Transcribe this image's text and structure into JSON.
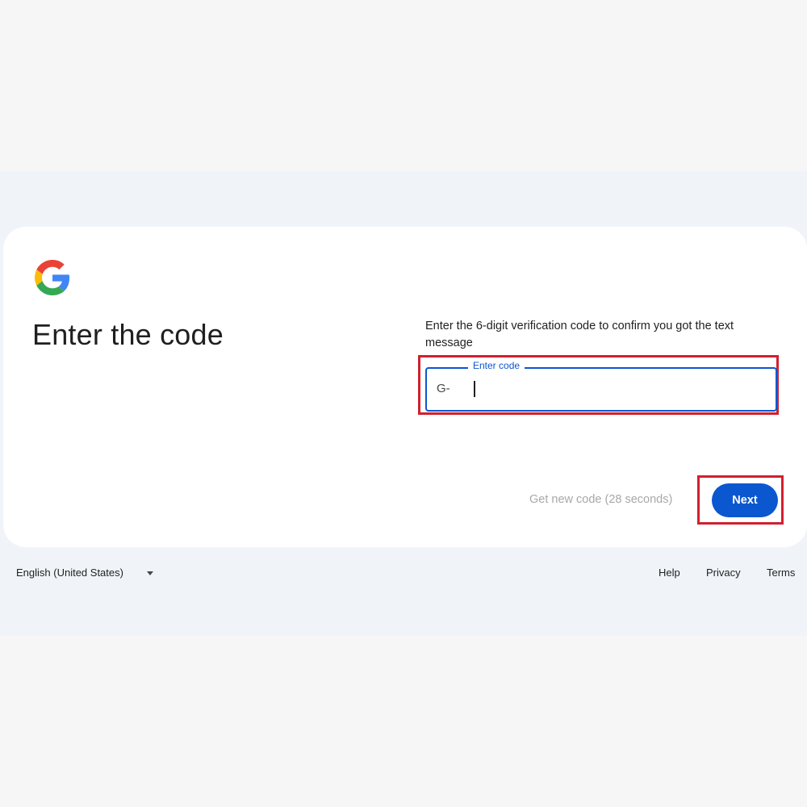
{
  "header": {
    "logo_icon": "google-g-icon",
    "title": "Enter the code"
  },
  "main": {
    "instructions": "Enter the 6-digit verification code to confirm you got the text message",
    "code_field": {
      "label": "Enter code",
      "prefix": "G-",
      "value": "",
      "caret_visible": true
    },
    "resend_label": "Get new code (28 seconds)",
    "next_label": "Next"
  },
  "footer": {
    "language": "English (United States)",
    "language_icon": "chevron-down-icon",
    "links": {
      "help": "Help",
      "privacy": "Privacy",
      "terms": "Terms"
    }
  },
  "colors": {
    "accent": "#0b57d0",
    "highlight": "#d1202f",
    "card_background": "#ffffff",
    "page_band": "#f0f4f9",
    "muted_text": "#a8a8a8"
  }
}
